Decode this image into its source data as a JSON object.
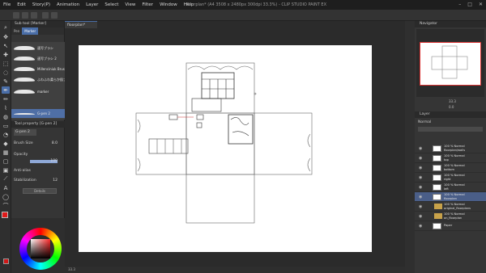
{
  "app": {
    "doc_title": "floorplan* (A4 3508 x 2480px 300dpi 33.3%) - CLIP STUDIO PAINT EX"
  },
  "menu": [
    "File",
    "Edit",
    "Story(P)",
    "Animation",
    "Layer",
    "Select",
    "View",
    "Filter",
    "Window",
    "Help"
  ],
  "window_controls": [
    "–",
    "□",
    "✕"
  ],
  "document": {
    "tab_label": "floorplan*"
  },
  "subtool": {
    "header": "Sub tool [Marker]",
    "tabs": [
      "Pen",
      "Marker"
    ],
    "brushes": [
      {
        "label": "速写ブラシ"
      },
      {
        "label": "速写ブラシ 2"
      },
      {
        "label": "Millenciniuk Brush"
      },
      {
        "label": "ふわふわ柔らか肌ブラシ"
      },
      {
        "label": "marker"
      },
      {
        "label": "G-pen 2"
      }
    ],
    "selected_index": 5
  },
  "tool_property": {
    "header": "Tool property [G-pen 2]",
    "name_field": "G-pen 2",
    "brush_size": {
      "label": "Brush Size",
      "value": "8.0"
    },
    "opacity": {
      "label": "Opacity",
      "value": "100",
      "level": 1.0
    },
    "antialias": {
      "label": "Anti-alias"
    },
    "stabilization": {
      "label": "Stabilization",
      "value": "12"
    },
    "detail_button": "Details"
  },
  "navigator": {
    "header": "Navigator",
    "zoom": "33.3",
    "rotate": "0.0"
  },
  "layer_panel": {
    "header": "Layer",
    "blend_mode": "Normal",
    "layers": [
      {
        "name_line1": "100 % Normal",
        "name_line2": "floorplan/walls",
        "type": "raster",
        "selected": false
      },
      {
        "name_line1": "100 % Normal",
        "name_line2": "top",
        "type": "raster",
        "selected": false
      },
      {
        "name_line1": "100 % Normal",
        "name_line2": "bottom",
        "type": "raster",
        "selected": false
      },
      {
        "name_line1": "100 % Normal",
        "name_line2": "right",
        "type": "raster",
        "selected": false
      },
      {
        "name_line1": "100 % Normal",
        "name_line2": "left",
        "type": "raster",
        "selected": false
      },
      {
        "name_line1": "100 % Normal",
        "name_line2": "floorplan",
        "type": "raster",
        "selected": true
      },
      {
        "name_line1": "100 % Normal",
        "name_line2": "original_floorplans",
        "type": "folder",
        "selected": false
      },
      {
        "name_line1": "100 % Normal",
        "name_line2": "on_floorplan",
        "type": "folder",
        "selected": false
      },
      {
        "name_line1": "Paper",
        "name_line2": "",
        "type": "raster",
        "selected": false
      }
    ]
  },
  "status": {
    "zoom": "33.3"
  },
  "colors": {
    "main": "#e01a1a",
    "accent": "#4a6ea8"
  }
}
